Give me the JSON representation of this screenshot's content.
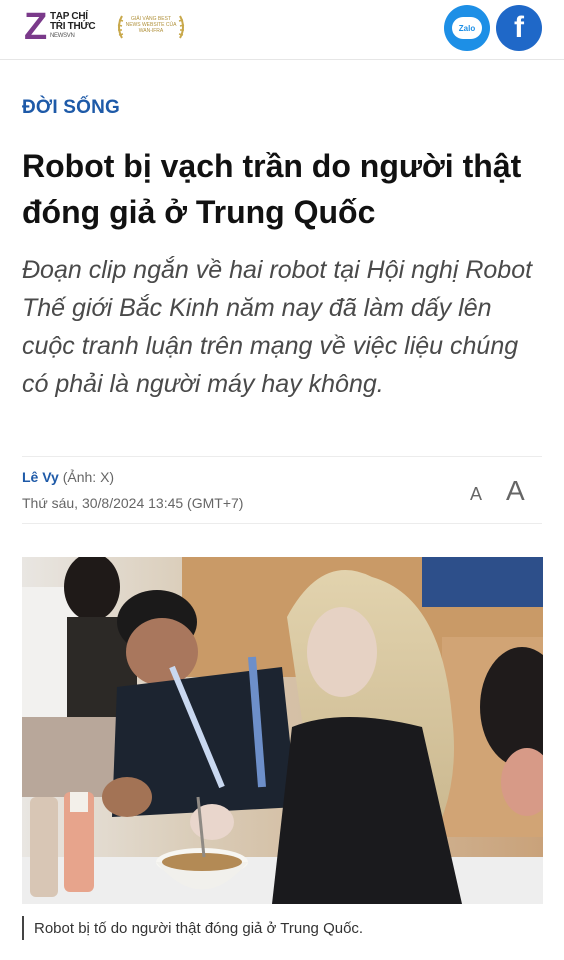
{
  "header": {
    "logo_line1": "TẠP CHÍ",
    "logo_line2": "TRI THỨC",
    "logo_line3": "NEWSVN",
    "award_text": "GIẢI VÀNG BEST NEWS WEBSITE CỦA WAN-IFRA",
    "zalo_label": "Zalo",
    "facebook_label": "f",
    "colors": {
      "zalo": "#1d8fe6",
      "facebook": "#1f68c8",
      "logo": "#7a3a8a",
      "accent": "#1e5aa8"
    }
  },
  "article": {
    "category": "ĐỜI SỐNG",
    "title": "Robot bị vạch trần do người thật đóng giả ở Trung Quốc",
    "sapo": "Đoạn clip ngắn về hai robot tại Hội nghị Robot Thế giới Bắc Kinh năm nay đã làm dấy lên cuộc tranh luận trên mạng về việc liệu chúng có phải là người máy hay không.",
    "author": "Lê Vy",
    "photo_credit": "(Ảnh: X)",
    "date": "Thứ sáu, 30/8/2024 13:45 (GMT+7)",
    "font_small_label": "A",
    "font_large_label": "A",
    "photo_caption": "Robot bị tố do người thật đóng giả ở Trung Quốc."
  }
}
